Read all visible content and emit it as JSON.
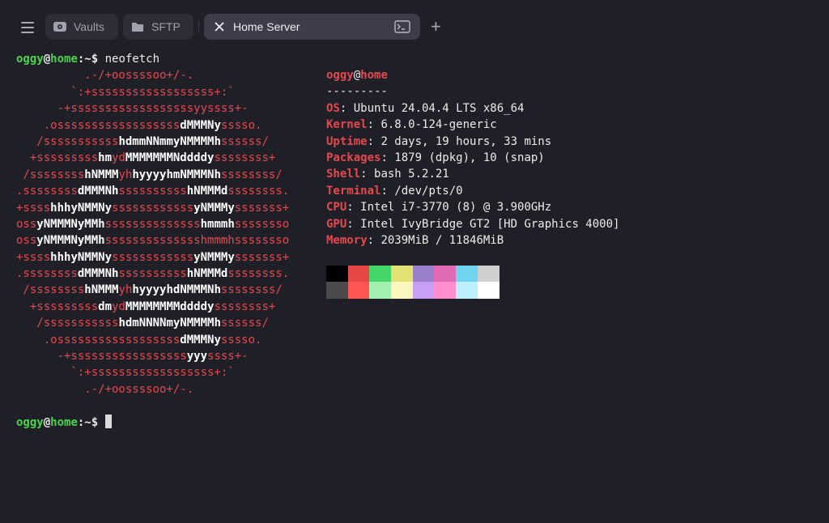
{
  "tabs": {
    "vaults": "Vaults",
    "sftp": "SFTP",
    "active": "Home Server"
  },
  "terminal": {
    "prompt_user": "oggy",
    "prompt_at": "@",
    "prompt_host": "home",
    "prompt_path": ":~$ ",
    "command": "neofetch"
  },
  "logo": [
    [
      [
        "r",
        "          .-/+oossssoo+/-."
      ]
    ],
    [
      [
        "r",
        "        `:+ssssssssssssssssss+:`"
      ]
    ],
    [
      [
        "r",
        "      -+ssssssssssssssssssyyssss+-"
      ]
    ],
    [
      [
        "r",
        "    .ossssssssssssssssss"
      ],
      [
        "w",
        "dMMMNy"
      ],
      [
        "r",
        "sssso."
      ]
    ],
    [
      [
        "r",
        "   /sssssssssss"
      ],
      [
        "w",
        "hdmmNNmmyNMMMMh"
      ],
      [
        "r",
        "ssssss/"
      ]
    ],
    [
      [
        "r",
        "  +sssssssss"
      ],
      [
        "w",
        "hm"
      ],
      [
        "r",
        "yd"
      ],
      [
        "w",
        "MMMMMMMNddddy"
      ],
      [
        "r",
        "ssssssss+"
      ]
    ],
    [
      [
        "r",
        " /ssssssss"
      ],
      [
        "w",
        "hNMMM"
      ],
      [
        "r",
        "yh"
      ],
      [
        "w",
        "hyyyyhmNMMMNh"
      ],
      [
        "r",
        "ssssssss/"
      ]
    ],
    [
      [
        "r",
        ".ssssssss"
      ],
      [
        "w",
        "dMMMNh"
      ],
      [
        "r",
        "ssssssssss"
      ],
      [
        "w",
        "hNMMMd"
      ],
      [
        "r",
        "ssssssss."
      ]
    ],
    [
      [
        "r",
        "+ssss"
      ],
      [
        "w",
        "hhhyNMMNy"
      ],
      [
        "r",
        "ssssssssssss"
      ],
      [
        "w",
        "yNMMMy"
      ],
      [
        "r",
        "sssssss+"
      ]
    ],
    [
      [
        "r",
        "oss"
      ],
      [
        "w",
        "yNMMMNyMMh"
      ],
      [
        "r",
        "ssssssssssssss"
      ],
      [
        "w",
        "hmmmh"
      ],
      [
        "r",
        "ssssssso"
      ]
    ],
    [
      [
        "r",
        "oss"
      ],
      [
        "w",
        "yNMMMNyMMh"
      ],
      [
        "r",
        "sssssssssssssshmmmhssssssso"
      ]
    ],
    [
      [
        "r",
        "+ssss"
      ],
      [
        "w",
        "hhhyNMMNy"
      ],
      [
        "r",
        "ssssssssssss"
      ],
      [
        "w",
        "yNMMMy"
      ],
      [
        "r",
        "sssssss+"
      ]
    ],
    [
      [
        "r",
        ".ssssssss"
      ],
      [
        "w",
        "dMMMNh"
      ],
      [
        "r",
        "ssssssssss"
      ],
      [
        "w",
        "hNMMMd"
      ],
      [
        "r",
        "ssssssss."
      ]
    ],
    [
      [
        "r",
        " /ssssssss"
      ],
      [
        "w",
        "hNMMM"
      ],
      [
        "r",
        "yh"
      ],
      [
        "w",
        "hyyyyhdNMMMNh"
      ],
      [
        "r",
        "ssssssss/"
      ]
    ],
    [
      [
        "r",
        "  +sssssssss"
      ],
      [
        "w",
        "dm"
      ],
      [
        "r",
        "yd"
      ],
      [
        "w",
        "MMMMMMMMddddy"
      ],
      [
        "r",
        "ssssssss+"
      ]
    ],
    [
      [
        "r",
        "   /sssssssssss"
      ],
      [
        "w",
        "hdmNNNNmyNMMMMh"
      ],
      [
        "r",
        "ssssss/"
      ]
    ],
    [
      [
        "r",
        "    .ossssssssssssssssss"
      ],
      [
        "w",
        "dMMMNy"
      ],
      [
        "r",
        "sssso."
      ]
    ],
    [
      [
        "r",
        "      -+sssssssssssssssss"
      ],
      [
        "w",
        "yyy"
      ],
      [
        "r",
        "ssss+-"
      ]
    ],
    [
      [
        "r",
        "        `:+ssssssssssssssssss+:`"
      ]
    ],
    [
      [
        "r",
        "          .-/+oossssoo+/-."
      ]
    ]
  ],
  "info": {
    "user": "oggy",
    "at": "@",
    "host": "home",
    "separator": "---------",
    "rows": [
      {
        "key": "OS",
        "value": "Ubuntu 24.04.4 LTS x86_64"
      },
      {
        "key": "Kernel",
        "value": "6.8.0-124-generic"
      },
      {
        "key": "Uptime",
        "value": "2 days, 19 hours, 33 mins"
      },
      {
        "key": "Packages",
        "value": "1879 (dpkg), 10 (snap)"
      },
      {
        "key": "Shell",
        "value": "bash 5.2.21"
      },
      {
        "key": "Terminal",
        "value": "/dev/pts/0"
      },
      {
        "key": "CPU",
        "value": "Intel i7-3770 (8) @ 3.900GHz"
      },
      {
        "key": "GPU",
        "value": "Intel IvyBridge GT2 [HD Graphics 4000]"
      },
      {
        "key": "Memory",
        "value": "2039MiB / 11846MiB"
      }
    ]
  },
  "palette": {
    "normal": [
      "#000000",
      "#e54646",
      "#45d66a",
      "#e1e273",
      "#9a7fca",
      "#e06ab3",
      "#71d4ee",
      "#cfcfcf"
    ],
    "bright": [
      "#4a4a4a",
      "#ff5555",
      "#a3f0b0",
      "#fbf7be",
      "#c89ff6",
      "#ff8ecf",
      "#bdefff",
      "#ffffff"
    ]
  }
}
